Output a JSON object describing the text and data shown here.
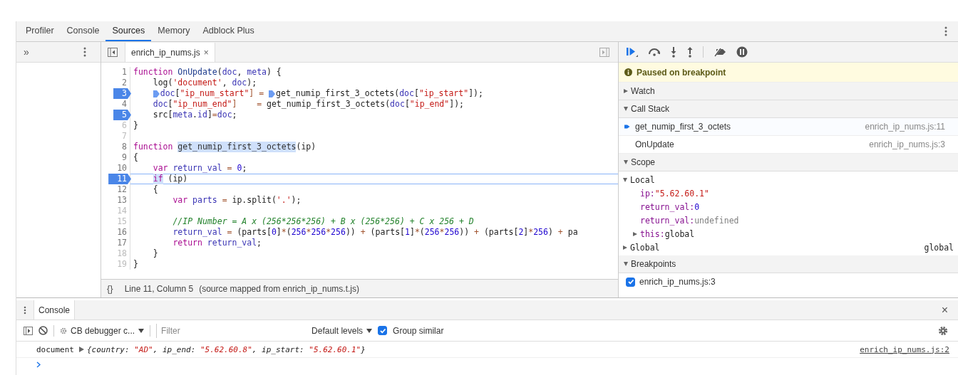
{
  "panel_tabs": [
    {
      "label": "Profiler",
      "selected": false
    },
    {
      "label": "Console",
      "selected": false
    },
    {
      "label": "Sources",
      "selected": true
    },
    {
      "label": "Memory",
      "selected": false
    },
    {
      "label": "Adblock Plus",
      "selected": false
    }
  ],
  "navigator": {
    "more": "»"
  },
  "sources": {
    "file_tab": {
      "label": "enrich_ip_nums.js",
      "close": "×"
    },
    "code_lines": [
      {
        "number": "1",
        "breakpoint": false,
        "current": false,
        "disabled": false,
        "tokens": [
          {
            "t": "function ",
            "kind": "keyword"
          },
          {
            "t": "OnUpdate",
            "kind": "definition"
          },
          {
            "t": "(",
            "kind": "plain"
          },
          {
            "t": "doc",
            "kind": "variable"
          },
          {
            "t": ", ",
            "kind": "plain"
          },
          {
            "t": "meta",
            "kind": "variable"
          },
          {
            "t": ") {",
            "kind": "plain"
          }
        ]
      },
      {
        "number": "2",
        "breakpoint": false,
        "current": false,
        "disabled": false,
        "tokens": [
          {
            "t": "    log(",
            "kind": "plain"
          },
          {
            "t": "'document'",
            "kind": "string"
          },
          {
            "t": ", ",
            "kind": "plain"
          },
          {
            "t": "doc",
            "kind": "variable"
          },
          {
            "t": ");",
            "kind": "plain"
          }
        ]
      },
      {
        "number": "3",
        "breakpoint": true,
        "current": false,
        "disabled": false,
        "tokens": [
          {
            "t": "    doc",
            "kind": "variable",
            "mark": true
          },
          {
            "t": "[",
            "kind": "plain"
          },
          {
            "t": "\"ip_num_start\"",
            "kind": "string"
          },
          {
            "t": "] = ",
            "kind": "operator"
          },
          {
            "t": "get_numip_first_3_octets(",
            "kind": "plain",
            "mark": true
          },
          {
            "t": "doc",
            "kind": "variable"
          },
          {
            "t": "[",
            "kind": "plain"
          },
          {
            "t": "\"ip_start\"",
            "kind": "string"
          },
          {
            "t": "]);",
            "kind": "plain"
          }
        ]
      },
      {
        "number": "4",
        "breakpoint": false,
        "current": false,
        "disabled": false,
        "tokens": [
          {
            "t": "    doc",
            "kind": "variable"
          },
          {
            "t": "[",
            "kind": "plain"
          },
          {
            "t": "\"ip_num_end\"",
            "kind": "string"
          },
          {
            "t": "]    =",
            "kind": "operator"
          },
          {
            "t": " get_numip_first_3_octets(",
            "kind": "plain"
          },
          {
            "t": "doc",
            "kind": "variable"
          },
          {
            "t": "[",
            "kind": "plain"
          },
          {
            "t": "\"ip_end\"",
            "kind": "string"
          },
          {
            "t": "]);",
            "kind": "plain"
          }
        ]
      },
      {
        "number": "5",
        "breakpoint": true,
        "current": false,
        "disabled": false,
        "tokens": [
          {
            "t": "    src[",
            "kind": "plain"
          },
          {
            "t": "meta",
            "kind": "variable"
          },
          {
            "t": ".",
            "kind": "plain"
          },
          {
            "t": "id",
            "kind": "variable"
          },
          {
            "t": "]",
            "kind": "plain"
          },
          {
            "t": "=",
            "kind": "operator"
          },
          {
            "t": "doc",
            "kind": "variable"
          },
          {
            "t": ";",
            "kind": "plain"
          }
        ]
      },
      {
        "number": "6",
        "breakpoint": false,
        "current": false,
        "disabled": true,
        "tokens": [
          {
            "t": "}",
            "kind": "plain"
          }
        ]
      },
      {
        "number": "7",
        "breakpoint": false,
        "current": false,
        "disabled": true
      },
      {
        "number": "8",
        "breakpoint": false,
        "current": false,
        "disabled": false,
        "tokens": [
          {
            "t": "function ",
            "kind": "keyword"
          },
          {
            "t": "get_numip_first_3_octets",
            "kind": "highlight"
          },
          {
            "t": "(ip)",
            "kind": "plain"
          }
        ]
      },
      {
        "number": "9",
        "breakpoint": false,
        "current": false,
        "disabled": false,
        "tokens": [
          {
            "t": "{",
            "kind": "plain"
          }
        ]
      },
      {
        "number": "10",
        "breakpoint": false,
        "current": false,
        "disabled": false,
        "tokens": [
          {
            "t": "    var ",
            "kind": "keyword"
          },
          {
            "t": "return_val",
            "kind": "variable"
          },
          {
            "t": " = ",
            "kind": "operator"
          },
          {
            "t": "0",
            "kind": "number"
          },
          {
            "t": ";",
            "kind": "plain"
          }
        ]
      },
      {
        "number": "11",
        "breakpoint": true,
        "current": true,
        "disabled": false,
        "tokens": [
          {
            "t": "    if",
            "kind": "keyword-highlight"
          },
          {
            "t": " (ip)",
            "kind": "plain"
          }
        ]
      },
      {
        "number": "12",
        "breakpoint": false,
        "current": false,
        "disabled": false,
        "tokens": [
          {
            "t": "    {",
            "kind": "plain"
          }
        ]
      },
      {
        "number": "13",
        "breakpoint": false,
        "current": false,
        "disabled": false,
        "tokens": [
          {
            "t": "        var ",
            "kind": "keyword"
          },
          {
            "t": "parts",
            "kind": "variable"
          },
          {
            "t": " = ",
            "kind": "operator"
          },
          {
            "t": "ip.split(",
            "kind": "plain"
          },
          {
            "t": "'.'",
            "kind": "string"
          },
          {
            "t": ");",
            "kind": "plain"
          }
        ]
      },
      {
        "number": "14",
        "breakpoint": false,
        "current": false,
        "disabled": true
      },
      {
        "number": "15",
        "breakpoint": false,
        "current": false,
        "disabled": true,
        "tokens": [
          {
            "t": "        //IP Number = A x (256*256*256) + B x (256*256) + C x 256 + D",
            "kind": "comment"
          }
        ]
      },
      {
        "number": "16",
        "breakpoint": false,
        "current": false,
        "disabled": false,
        "tokens": [
          {
            "t": "        return_val",
            "kind": "variable"
          },
          {
            "t": " = ",
            "kind": "operator"
          },
          {
            "t": "(parts[",
            "kind": "plain"
          },
          {
            "t": "0",
            "kind": "number"
          },
          {
            "t": "]",
            "kind": "plain"
          },
          {
            "t": "*",
            "kind": "operator"
          },
          {
            "t": "(",
            "kind": "plain"
          },
          {
            "t": "256",
            "kind": "number"
          },
          {
            "t": "*",
            "kind": "operator"
          },
          {
            "t": "256",
            "kind": "number"
          },
          {
            "t": "*",
            "kind": "operator"
          },
          {
            "t": "256",
            "kind": "number"
          },
          {
            "t": "))",
            "kind": "plain"
          },
          {
            "t": " + ",
            "kind": "operator"
          },
          {
            "t": "(parts[",
            "kind": "plain"
          },
          {
            "t": "1",
            "kind": "number"
          },
          {
            "t": "]",
            "kind": "plain"
          },
          {
            "t": "*",
            "kind": "operator"
          },
          {
            "t": "(",
            "kind": "plain"
          },
          {
            "t": "256",
            "kind": "number"
          },
          {
            "t": "*",
            "kind": "operator"
          },
          {
            "t": "256",
            "kind": "number"
          },
          {
            "t": "))",
            "kind": "plain"
          },
          {
            "t": " + ",
            "kind": "operator"
          },
          {
            "t": "(parts[",
            "kind": "plain"
          },
          {
            "t": "2",
            "kind": "number"
          },
          {
            "t": "]",
            "kind": "plain"
          },
          {
            "t": "*",
            "kind": "operator"
          },
          {
            "t": "256",
            "kind": "number"
          },
          {
            "t": ")",
            "kind": "plain"
          },
          {
            "t": " + ",
            "kind": "operator"
          },
          {
            "t": "pa",
            "kind": "plain"
          }
        ]
      },
      {
        "number": "17",
        "breakpoint": false,
        "current": false,
        "disabled": false,
        "tokens": [
          {
            "t": "        return ",
            "kind": "keyword"
          },
          {
            "t": "return_val",
            "kind": "variable"
          },
          {
            "t": ";",
            "kind": "plain"
          }
        ]
      },
      {
        "number": "18",
        "breakpoint": false,
        "current": false,
        "disabled": true,
        "tokens": [
          {
            "t": "    }",
            "kind": "plain"
          }
        ]
      },
      {
        "number": "19",
        "breakpoint": false,
        "current": false,
        "disabled": true,
        "tokens": [
          {
            "t": "}",
            "kind": "plain"
          }
        ]
      }
    ],
    "status": {
      "icon": "{}",
      "position": "Line 11, Column 5",
      "note": "(source mapped from enrich_ip_nums.t.js)"
    }
  },
  "debugger": {
    "paused_message": "Paused on breakpoint",
    "watch": {
      "title": "Watch",
      "expanded": false
    },
    "call_stack": {
      "title": "Call Stack",
      "expanded": true,
      "frames": [
        {
          "name": "get_numip_first_3_octets",
          "location": "enrich_ip_nums.js:11",
          "selected": true
        },
        {
          "name": "OnUpdate",
          "location": "enrich_ip_nums.js:3",
          "selected": false
        }
      ]
    },
    "scope": {
      "title": "Scope",
      "expanded": true,
      "groups": [
        {
          "name": "Local",
          "expanded": true,
          "vars": [
            {
              "name": "ip:",
              "value": "\"5.62.60.1\"",
              "kind": "string",
              "expandable": false
            },
            {
              "name": "return_val:",
              "value": "0",
              "kind": "number",
              "expandable": false
            },
            {
              "name": "return_val:",
              "value": "undefined",
              "kind": "undefined",
              "expandable": false
            },
            {
              "name": "this:",
              "value": "global",
              "kind": "object",
              "expandable": true
            }
          ]
        },
        {
          "name": "Global",
          "expanded": false,
          "value": "global"
        }
      ]
    },
    "breakpoints": {
      "title": "Breakpoints",
      "expanded": true,
      "items": [
        {
          "label": "enrich_ip_nums.js:3",
          "checked": true
        }
      ]
    }
  },
  "drawer": {
    "tab": "Console",
    "close": "×",
    "context": "CB debugger c...",
    "filter_placeholder": "Filter",
    "levels": "Default levels",
    "group_similar": {
      "label": "Group similar",
      "checked": true
    },
    "messages": [
      {
        "label": "document",
        "tokens": [
          {
            "t": "{country: ",
            "kind": "plain"
          },
          {
            "t": "\"AD\"",
            "kind": "string"
          },
          {
            "t": ", ip_end: ",
            "kind": "plain"
          },
          {
            "t": "\"5.62.60.8\"",
            "kind": "string"
          },
          {
            "t": ", ip_start: ",
            "kind": "plain"
          },
          {
            "t": "\"5.62.60.1\"",
            "kind": "string"
          },
          {
            "t": "}",
            "kind": "plain"
          }
        ],
        "source": "enrich_ip_nums.js:2"
      }
    ]
  }
}
